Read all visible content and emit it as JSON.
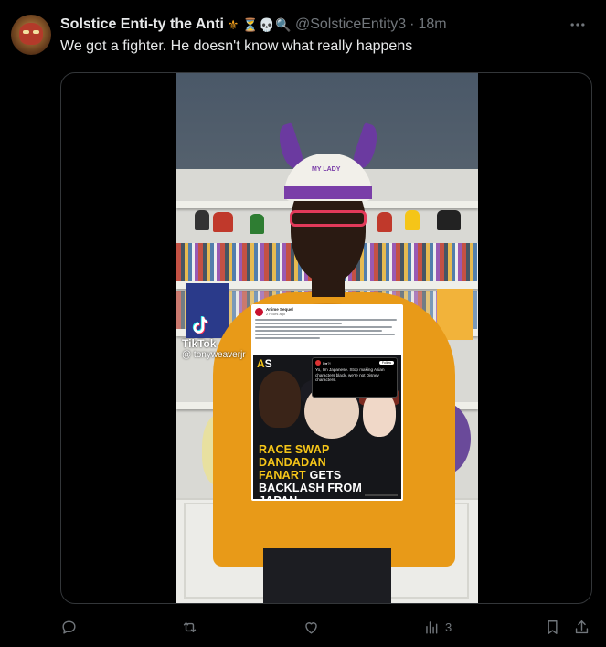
{
  "post": {
    "display_name": "Solstice Enti-ty the Anti",
    "name_emojis": [
      "⚜",
      "⏳",
      "💀",
      "🔍"
    ],
    "handle": "@SolsticeEntity3",
    "separator": "·",
    "time": "18m",
    "text": "We got a fighter. He doesn't know what really happens"
  },
  "media": {
    "watermark_brand": "TikTok",
    "watermark_user": "@ tonyweaverjr",
    "cap_text": "MY LADY",
    "card": {
      "source_name": "Anime Sequel",
      "source_meta": "2 hours ago",
      "brand_a": "A",
      "brand_s": "S",
      "quote_name": "D●?!",
      "quote_follow": "Follow",
      "quote_text": "Yo, I'm Japanese. Stop making Asian characters black, we're not Disney characters.",
      "headline_l1": "RACE SWAP DANDADAN",
      "headline_l2a": "FANART",
      "headline_l2b": " GETS",
      "headline_l3": "BACKLASH FROM JAPAN"
    }
  },
  "actions": {
    "reply_count": "",
    "repost_count": "",
    "like_count": "",
    "views_count": "3"
  },
  "colors": {
    "background": "#000000",
    "text_primary": "#e7e9ea",
    "text_secondary": "#71767b",
    "border": "#333639"
  },
  "icons": [
    "avatar",
    "more-icon",
    "reply-icon",
    "repost-icon",
    "like-icon",
    "views-icon",
    "bookmark-icon",
    "share-icon",
    "tiktok-icon"
  ]
}
